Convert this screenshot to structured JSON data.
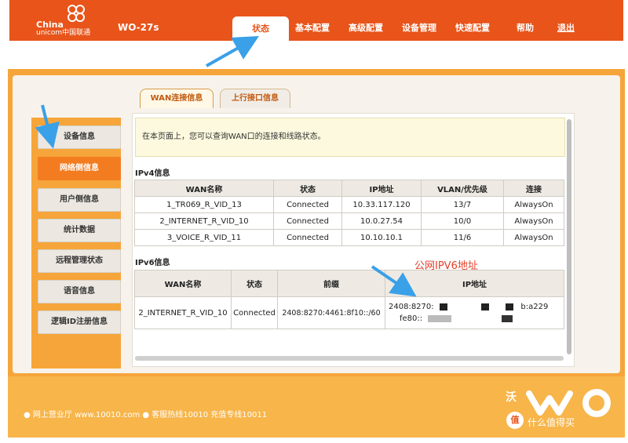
{
  "header": {
    "logo_cn": "China",
    "logo_en": "unicom中国联通",
    "model": "WO-27s",
    "nav": [
      "状态",
      "基本配置",
      "高级配置",
      "设备管理",
      "快速配置",
      "帮助",
      "退出"
    ]
  },
  "tabs": [
    "WAN连接信息",
    "上行接口信息"
  ],
  "sidebar": [
    "设备信息",
    "网络侧信息",
    "用户侧信息",
    "统计数据",
    "远程管理状态",
    "语音信息",
    "逻辑ID注册信息"
  ],
  "notice": "在本页面上，您可以查询WAN口的连接和线路状态。",
  "ipv4": {
    "title": "IPv4信息",
    "headers": [
      "WAN名称",
      "状态",
      "IP地址",
      "VLAN/优先级",
      "连接"
    ],
    "rows": [
      [
        "1_TR069_R_VID_13",
        "Connected",
        "10.33.117.120",
        "13/7",
        "AlwaysOn"
      ],
      [
        "2_INTERNET_R_VID_10",
        "Connected",
        "10.0.27.54",
        "10/0",
        "AlwaysOn"
      ],
      [
        "3_VOICE_R_VID_11",
        "Connected",
        "10.10.10.1",
        "11/6",
        "AlwaysOn"
      ]
    ]
  },
  "ipv6": {
    "title": "IPv6信息",
    "headers": [
      "WAN名称",
      "状态",
      "前缀",
      "IP地址"
    ],
    "row": {
      "name": "2_INTERNET_R_VID_10",
      "status": "Connected",
      "prefix": "2408:8270:4461:8f10::/60",
      "ip1": "2408:8270:",
      "ip1_tail": "b:a229",
      "ip2": "fe80::"
    }
  },
  "annotation": "公网IPV6地址",
  "footer": "● 网上营业厅  www.10010.com ● 客服热线10010  充值专线10011",
  "watermark": "什么值得买",
  "watermark_badge": "值",
  "brand_kuai": "沃",
  "colors": {
    "brand": "#e8541a",
    "frame": "#f6a53a",
    "active_side": "#f47c20",
    "annotation": "#e4402a"
  }
}
